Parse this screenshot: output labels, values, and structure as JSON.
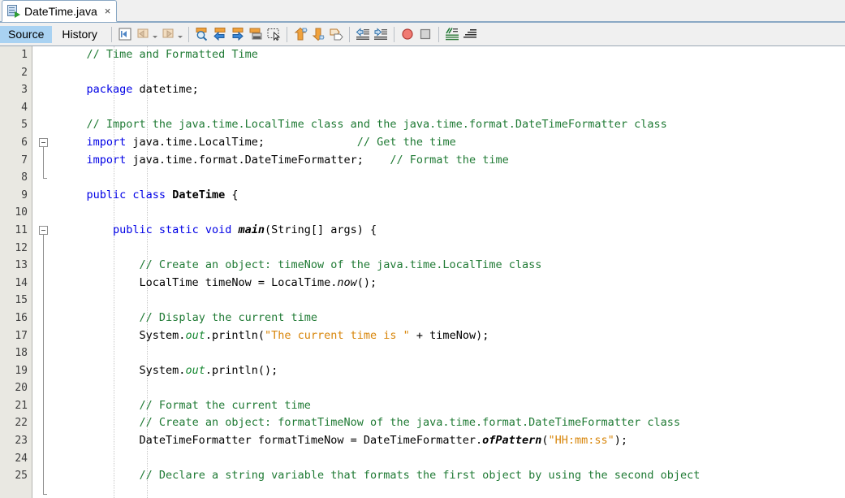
{
  "window": {
    "tab": {
      "title": "DateTime.java",
      "icon": "java-file-icon",
      "close": "×"
    }
  },
  "toolbar": {
    "view_buttons": [
      {
        "label": "Source",
        "active": true
      },
      {
        "label": "History",
        "active": false
      }
    ],
    "icons": [
      "toggle-rectangular-selection-icon",
      "back-icon",
      "back-dropdown-caret",
      "forward-icon",
      "forward-dropdown-caret",
      "find-selection-icon",
      "find-previous-icon",
      "find-next-icon",
      "toggle-highlight-search-icon",
      "toggle-rectangular-select-icon",
      "previous-bookmark-icon",
      "next-bookmark-icon",
      "toggle-bookmark-icon",
      "shift-line-left-icon",
      "shift-line-right-icon",
      "start-macro-recording-icon",
      "stop-macro-recording-icon",
      "comment-icon",
      "uncomment-icon"
    ]
  },
  "editor": {
    "line_numbers": [
      1,
      2,
      3,
      4,
      5,
      6,
      7,
      8,
      9,
      10,
      11,
      12,
      13,
      14,
      15,
      16,
      17,
      18,
      19,
      20,
      21,
      22,
      23,
      24,
      25
    ],
    "fold_markers": [
      {
        "line": 6,
        "state": "expanded",
        "span_lines": 2
      },
      {
        "line": 11,
        "state": "expanded",
        "span_lines": 15
      }
    ],
    "lines": [
      {
        "n": 1,
        "tokens": [
          {
            "t": "    ",
            "c": "plain"
          },
          {
            "t": "// Time and Formatted Time",
            "c": "cmt"
          }
        ]
      },
      {
        "n": 2,
        "tokens": []
      },
      {
        "n": 3,
        "tokens": [
          {
            "t": "    ",
            "c": "plain"
          },
          {
            "t": "package",
            "c": "kw"
          },
          {
            "t": " datetime;",
            "c": "plain"
          }
        ]
      },
      {
        "n": 4,
        "tokens": []
      },
      {
        "n": 5,
        "tokens": [
          {
            "t": "    ",
            "c": "plain"
          },
          {
            "t": "// Import the java.time.LocalTime class and the java.time.format.DateTimeFormatter class",
            "c": "cmt"
          }
        ]
      },
      {
        "n": 6,
        "tokens": [
          {
            "t": "    ",
            "c": "plain"
          },
          {
            "t": "import",
            "c": "kw"
          },
          {
            "t": " java.time.LocalTime;              ",
            "c": "plain"
          },
          {
            "t": "// Get the time",
            "c": "cmt"
          }
        ]
      },
      {
        "n": 7,
        "tokens": [
          {
            "t": "    ",
            "c": "plain"
          },
          {
            "t": "import",
            "c": "kw"
          },
          {
            "t": " java.time.format.DateTimeFormatter;    ",
            "c": "plain"
          },
          {
            "t": "// Format the time",
            "c": "cmt"
          }
        ]
      },
      {
        "n": 8,
        "tokens": []
      },
      {
        "n": 9,
        "tokens": [
          {
            "t": "    ",
            "c": "plain"
          },
          {
            "t": "public class",
            "c": "kw"
          },
          {
            "t": " ",
            "c": "plain"
          },
          {
            "t": "DateTime",
            "c": "bold"
          },
          {
            "t": " {",
            "c": "plain"
          }
        ]
      },
      {
        "n": 10,
        "tokens": []
      },
      {
        "n": 11,
        "tokens": [
          {
            "t": "        ",
            "c": "plain"
          },
          {
            "t": "public static void",
            "c": "kw"
          },
          {
            "t": " ",
            "c": "plain"
          },
          {
            "t": "main",
            "c": "bi"
          },
          {
            "t": "(String[] args) {",
            "c": "plain"
          }
        ]
      },
      {
        "n": 12,
        "tokens": []
      },
      {
        "n": 13,
        "tokens": [
          {
            "t": "            ",
            "c": "plain"
          },
          {
            "t": "// Create an object: timeNow of the java.time.LocalTime class",
            "c": "cmt"
          }
        ]
      },
      {
        "n": 14,
        "tokens": [
          {
            "t": "            LocalTime timeNow = LocalTime.",
            "c": "plain"
          },
          {
            "t": "now",
            "c": "ital"
          },
          {
            "t": "();",
            "c": "plain"
          }
        ]
      },
      {
        "n": 15,
        "tokens": []
      },
      {
        "n": 16,
        "tokens": [
          {
            "t": "            ",
            "c": "plain"
          },
          {
            "t": "// Display the current time",
            "c": "cmt"
          }
        ]
      },
      {
        "n": 17,
        "tokens": [
          {
            "t": "            System.",
            "c": "plain"
          },
          {
            "t": "out",
            "c": "statfield"
          },
          {
            "t": ".println(",
            "c": "plain"
          },
          {
            "t": "\"The current time is \"",
            "c": "str"
          },
          {
            "t": " + timeNow);",
            "c": "plain"
          }
        ]
      },
      {
        "n": 18,
        "tokens": []
      },
      {
        "n": 19,
        "tokens": [
          {
            "t": "            System.",
            "c": "plain"
          },
          {
            "t": "out",
            "c": "statfield"
          },
          {
            "t": ".println();",
            "c": "plain"
          }
        ]
      },
      {
        "n": 20,
        "tokens": []
      },
      {
        "n": 21,
        "tokens": [
          {
            "t": "            ",
            "c": "plain"
          },
          {
            "t": "// Format the current time",
            "c": "cmt"
          }
        ]
      },
      {
        "n": 22,
        "tokens": [
          {
            "t": "            ",
            "c": "plain"
          },
          {
            "t": "// Create an object: formatTimeNow of the java.time.format.DateTimeFormatter class",
            "c": "cmt"
          }
        ]
      },
      {
        "n": 23,
        "tokens": [
          {
            "t": "            DateTimeFormatter formatTimeNow = DateTimeFormatter.",
            "c": "plain"
          },
          {
            "t": "ofPattern",
            "c": "bi"
          },
          {
            "t": "(",
            "c": "plain"
          },
          {
            "t": "\"HH:mm:ss\"",
            "c": "str"
          },
          {
            "t": ");",
            "c": "plain"
          }
        ]
      },
      {
        "n": 24,
        "tokens": []
      },
      {
        "n": 25,
        "tokens": [
          {
            "t": "            ",
            "c": "plain"
          },
          {
            "t": "// Declare a string variable that formats the first object by using the second object",
            "c": "cmt"
          }
        ]
      }
    ]
  },
  "colors": {
    "comment": "#1f7a34",
    "keyword": "#0000e6",
    "string": "#d8860b",
    "static_field": "#12862e",
    "gutter_bg": "#e9e8e2",
    "toolbar_bg": "#f0f0f0",
    "active_view_bg": "#a9d2f2",
    "tab_border": "#8aa8c4"
  }
}
